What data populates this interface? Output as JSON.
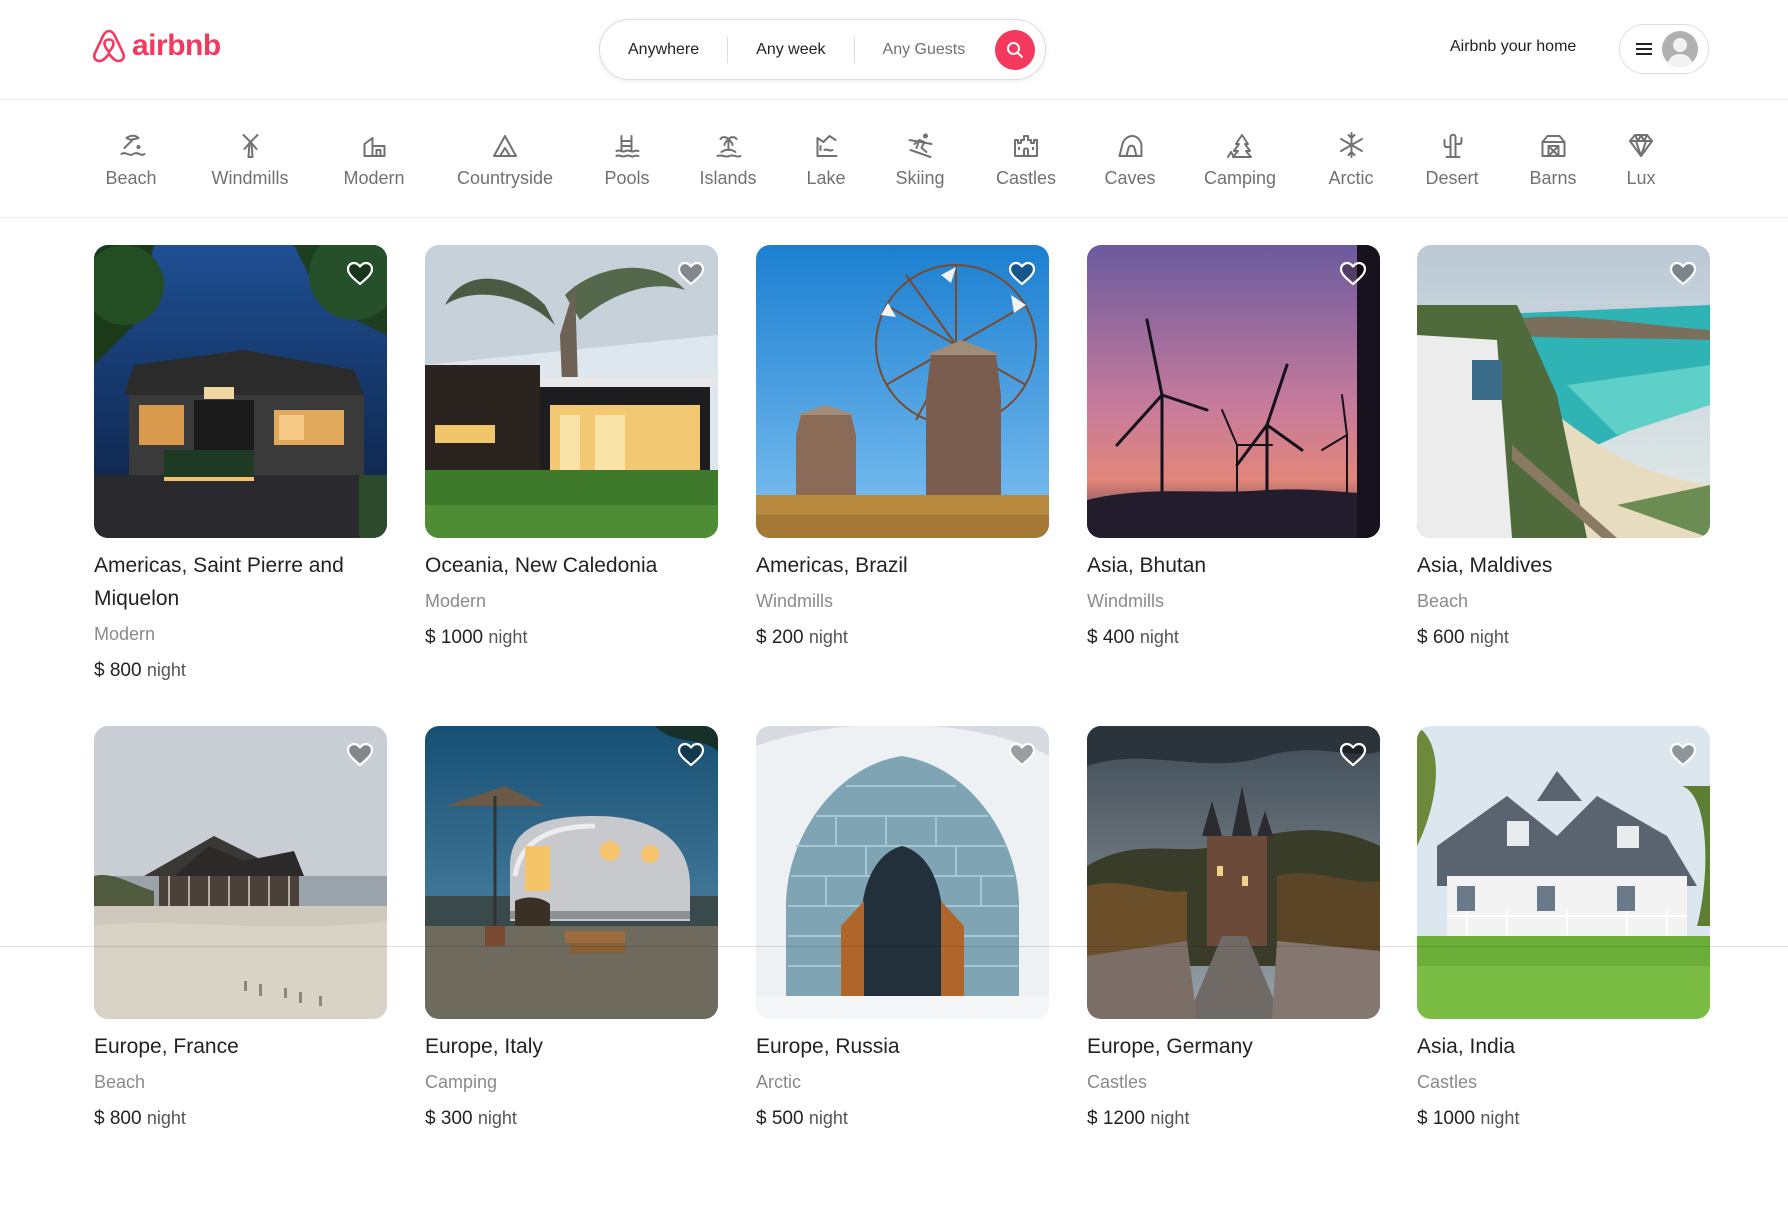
{
  "brand": {
    "name": "airbnb",
    "color": "#F5385D"
  },
  "search": {
    "where": "Anywhere",
    "when": "Any week",
    "who": "Any Guests",
    "icon": "search-icon"
  },
  "header": {
    "host_link": "Airbnb your home",
    "menu_icon": "hamburger-icon",
    "avatar_icon": "avatar-icon"
  },
  "categories": [
    {
      "label": "Beach",
      "icon": "beach-icon"
    },
    {
      "label": "Windmills",
      "icon": "windmill-icon"
    },
    {
      "label": "Modern",
      "icon": "modern-icon"
    },
    {
      "label": "Countryside",
      "icon": "mountain-icon"
    },
    {
      "label": "Pools",
      "icon": "pool-icon"
    },
    {
      "label": "Islands",
      "icon": "island-icon"
    },
    {
      "label": "Lake",
      "icon": "lake-icon"
    },
    {
      "label": "Skiing",
      "icon": "skiing-icon"
    },
    {
      "label": "Castles",
      "icon": "castle-icon"
    },
    {
      "label": "Caves",
      "icon": "cave-icon"
    },
    {
      "label": "Camping",
      "icon": "camping-icon"
    },
    {
      "label": "Arctic",
      "icon": "snowflake-icon"
    },
    {
      "label": "Desert",
      "icon": "cactus-icon"
    },
    {
      "label": "Barns",
      "icon": "barn-icon"
    },
    {
      "label": "Lux",
      "icon": "diamond-icon"
    }
  ],
  "listings": [
    {
      "location": "Americas, Saint Pierre and Miquelon",
      "category": "Modern",
      "price": "$ 800",
      "unit": "night",
      "scene": "modern-house-at-night"
    },
    {
      "location": "Oceania, New Caledonia",
      "category": "Modern",
      "price": "$ 1000",
      "unit": "night",
      "scene": "modern-house-with-tree"
    },
    {
      "location": "Americas, Brazil",
      "category": "Windmills",
      "price": "$ 200",
      "unit": "night",
      "scene": "stone-windmills"
    },
    {
      "location": "Asia, Bhutan",
      "category": "Windmills",
      "price": "$ 400",
      "unit": "night",
      "scene": "wind-turbines-at-dusk"
    },
    {
      "location": "Asia, Maldives",
      "category": "Beach",
      "price": "$ 600",
      "unit": "night",
      "scene": "coastal-cliff-beach"
    },
    {
      "location": "Europe, France",
      "category": "Beach",
      "price": "$ 800",
      "unit": "night",
      "scene": "beach-house-on-sand"
    },
    {
      "location": "Europe, Italy",
      "category": "Camping",
      "price": "$ 300",
      "unit": "night",
      "scene": "vintage-camper-trailer"
    },
    {
      "location": "Europe, Russia",
      "category": "Arctic",
      "price": "$ 500",
      "unit": "night",
      "scene": "ice-igloo-entrance"
    },
    {
      "location": "Europe, Germany",
      "category": "Castles",
      "price": "$ 1200",
      "unit": "night",
      "scene": "castle-in-forest"
    },
    {
      "location": "Asia, India",
      "category": "Castles",
      "price": "$ 1000",
      "unit": "night",
      "scene": "white-farmhouse"
    }
  ]
}
